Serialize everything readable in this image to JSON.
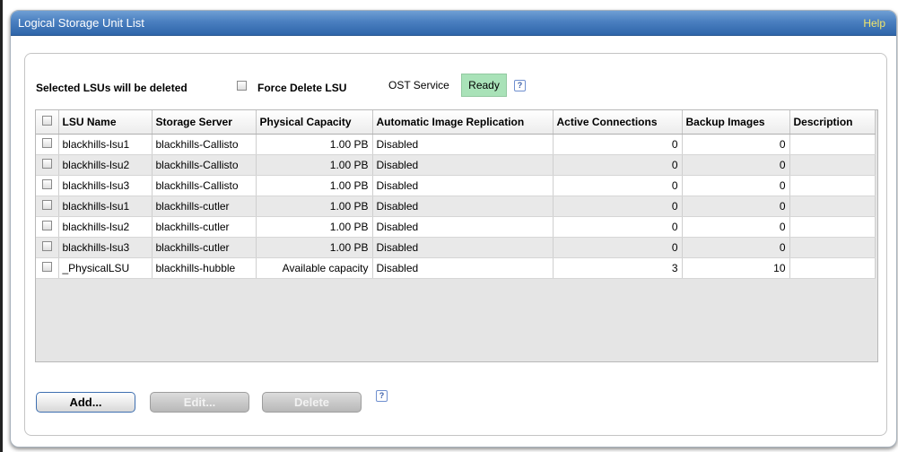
{
  "panel": {
    "title": "Logical Storage Unit List",
    "help_link": "Help"
  },
  "options": {
    "selected_label": "Selected LSUs will be deleted",
    "force_delete_label": "Force Delete LSU",
    "ost_service_label": "OST Service",
    "ost_status": "Ready",
    "help_glyph": "?"
  },
  "table": {
    "columns": [
      "LSU Name",
      "Storage Server",
      "Physical Capacity",
      "Automatic Image Replication",
      "Active Connections",
      "Backup Images",
      "Description"
    ],
    "rows": [
      [
        "blackhills-lsu1",
        "blackhills-Callisto",
        "1.00 PB",
        "Disabled",
        "0",
        "0",
        ""
      ],
      [
        "blackhills-lsu2",
        "blackhills-Callisto",
        "1.00 PB",
        "Disabled",
        "0",
        "0",
        ""
      ],
      [
        "blackhills-lsu3",
        "blackhills-Callisto",
        "1.00 PB",
        "Disabled",
        "0",
        "0",
        ""
      ],
      [
        "blackhills-lsu1",
        "blackhills-cutler",
        "1.00 PB",
        "Disabled",
        "0",
        "0",
        ""
      ],
      [
        "blackhills-lsu2",
        "blackhills-cutler",
        "1.00 PB",
        "Disabled",
        "0",
        "0",
        ""
      ],
      [
        "blackhills-lsu3",
        "blackhills-cutler",
        "1.00 PB",
        "Disabled",
        "0",
        "0",
        ""
      ],
      [
        "_PhysicalLSU",
        "blackhills-hubble",
        "Available capacity",
        "Disabled",
        "3",
        "10",
        ""
      ]
    ]
  },
  "buttons": {
    "add": "Add...",
    "edit": "Edit...",
    "delete": "Delete",
    "help_glyph": "?"
  },
  "colors": {
    "title_bar": "#4a7fc0",
    "help_link": "#f2e66a",
    "ready_badge": "#a9e2b8"
  }
}
